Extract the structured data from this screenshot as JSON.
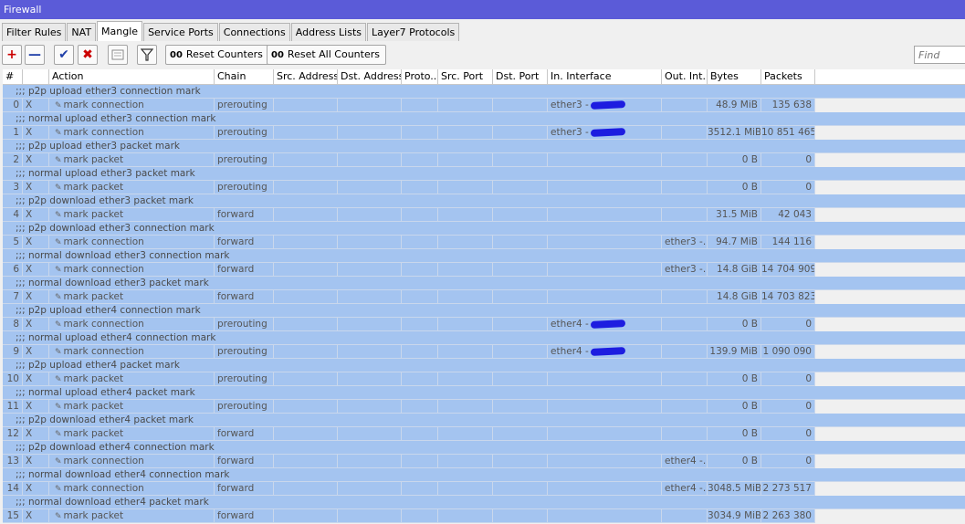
{
  "window": {
    "title": "Firewall"
  },
  "tabs": [
    {
      "label": "Filter Rules",
      "active": false
    },
    {
      "label": "NAT",
      "active": false
    },
    {
      "label": "Mangle",
      "active": true
    },
    {
      "label": "Service Ports",
      "active": false
    },
    {
      "label": "Connections",
      "active": false
    },
    {
      "label": "Address Lists",
      "active": false
    },
    {
      "label": "Layer7 Protocols",
      "active": false
    }
  ],
  "toolbar": {
    "reset_counters_label": "Reset Counters",
    "reset_all_counters_label": "Reset All Counters",
    "counter_icon_text": "00",
    "find_placeholder": "Find",
    "accent_add": "#cc0000",
    "accent_remove": "#1f3fa8"
  },
  "columns": [
    "#",
    "",
    "Action",
    "Chain",
    "Src. Address",
    "Dst. Address",
    "Proto...",
    "Src. Port",
    "Dst. Port",
    "In. Interface",
    "Out. Int...",
    "Bytes",
    "Packets"
  ],
  "rules": [
    {
      "comment": ";;; p2p upload ether3 connection mark",
      "num": "0",
      "flag": "X",
      "action": "mark connection",
      "chain": "prerouting",
      "in_iface": "ether3 -",
      "out_iface": "",
      "bytes": "48.9 MiB",
      "packets": "135 638",
      "redacted": true
    },
    {
      "comment": ";;; normal upload ether3 connection mark",
      "num": "1",
      "flag": "X",
      "action": "mark connection",
      "chain": "prerouting",
      "in_iface": "ether3 -",
      "out_iface": "",
      "bytes": "3512.1 MiB",
      "packets": "10 851 465",
      "redacted": true
    },
    {
      "comment": ";;; p2p upload ether3 packet mark",
      "num": "2",
      "flag": "X",
      "action": "mark packet",
      "chain": "prerouting",
      "in_iface": "",
      "out_iface": "",
      "bytes": "0 B",
      "packets": "0",
      "redacted": false
    },
    {
      "comment": ";;; normal upload ether3 packet mark",
      "num": "3",
      "flag": "X",
      "action": "mark packet",
      "chain": "prerouting",
      "in_iface": "",
      "out_iface": "",
      "bytes": "0 B",
      "packets": "0",
      "redacted": false
    },
    {
      "comment": ";;; p2p download ether3 packet mark",
      "num": "4",
      "flag": "X",
      "action": "mark packet",
      "chain": "forward",
      "in_iface": "",
      "out_iface": "",
      "bytes": "31.5 MiB",
      "packets": "42 043",
      "redacted": false
    },
    {
      "comment": ";;; p2p download ether3 connection mark",
      "num": "5",
      "flag": "X",
      "action": "mark connection",
      "chain": "forward",
      "in_iface": "",
      "out_iface": "ether3 -...",
      "bytes": "94.7 MiB",
      "packets": "144 116",
      "redacted": false
    },
    {
      "comment": ";;; normal download ether3 connection mark",
      "num": "6",
      "flag": "X",
      "action": "mark connection",
      "chain": "forward",
      "in_iface": "",
      "out_iface": "ether3 -...",
      "bytes": "14.8 GiB",
      "packets": "14 704 909",
      "redacted": false
    },
    {
      "comment": ";;; normal download ether3 packet mark",
      "num": "7",
      "flag": "X",
      "action": "mark packet",
      "chain": "forward",
      "in_iface": "",
      "out_iface": "",
      "bytes": "14.8 GiB",
      "packets": "14 703 823",
      "redacted": false
    },
    {
      "comment": ";;; p2p upload ether4 connection mark",
      "num": "8",
      "flag": "X",
      "action": "mark connection",
      "chain": "prerouting",
      "in_iface": "ether4 -",
      "out_iface": "",
      "bytes": "0 B",
      "packets": "0",
      "redacted": true
    },
    {
      "comment": ";;; normal upload ether4 connection mark",
      "num": "9",
      "flag": "X",
      "action": "mark connection",
      "chain": "prerouting",
      "in_iface": "ether4 -",
      "out_iface": "",
      "bytes": "139.9 MiB",
      "packets": "1 090 090",
      "redacted": true
    },
    {
      "comment": ";;; p2p upload ether4 packet mark",
      "num": "10",
      "flag": "X",
      "action": "mark packet",
      "chain": "prerouting",
      "in_iface": "",
      "out_iface": "",
      "bytes": "0 B",
      "packets": "0",
      "redacted": false
    },
    {
      "comment": ";;; normal upload ether4 packet mark",
      "num": "11",
      "flag": "X",
      "action": "mark packet",
      "chain": "prerouting",
      "in_iface": "",
      "out_iface": "",
      "bytes": "0 B",
      "packets": "0",
      "redacted": false
    },
    {
      "comment": ";;; p2p download ether4 packet mark",
      "num": "12",
      "flag": "X",
      "action": "mark packet",
      "chain": "forward",
      "in_iface": "",
      "out_iface": "",
      "bytes": "0 B",
      "packets": "0",
      "redacted": false
    },
    {
      "comment": ";;; p2p download ether4 connection mark",
      "num": "13",
      "flag": "X",
      "action": "mark connection",
      "chain": "forward",
      "in_iface": "",
      "out_iface": "ether4 -...",
      "bytes": "0 B",
      "packets": "0",
      "redacted": false
    },
    {
      "comment": ";;; normal download ether4 connection mark",
      "num": "14",
      "flag": "X",
      "action": "mark connection",
      "chain": "forward",
      "in_iface": "",
      "out_iface": "ether4 -...",
      "bytes": "3048.5 MiB",
      "packets": "2 273 517",
      "redacted": false
    },
    {
      "comment": ";;; normal download ether4 packet mark",
      "num": "15",
      "flag": "X",
      "action": "mark packet",
      "chain": "forward",
      "in_iface": "",
      "out_iface": "",
      "bytes": "3034.9 MiB",
      "packets": "2 263 380",
      "redacted": false
    }
  ]
}
